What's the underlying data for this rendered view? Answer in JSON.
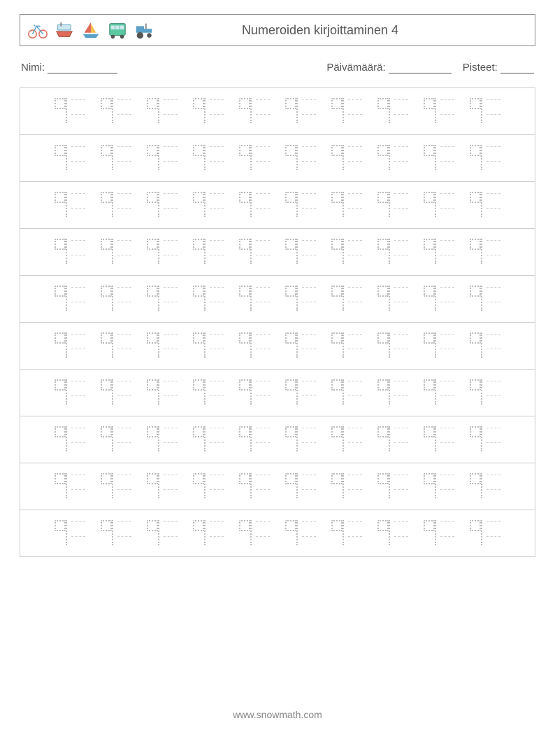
{
  "header": {
    "title": "Numeroiden kirjoittaminen 4",
    "icons": [
      "bicycle",
      "ship",
      "sailboat",
      "bus",
      "tractor"
    ]
  },
  "meta": {
    "name_label": "Nimi:",
    "date_label": "Päivämäärä:",
    "score_label": "Pisteet:"
  },
  "practice": {
    "digit": "9",
    "rows": 10,
    "cells_per_row": 10
  },
  "footer": {
    "url": "www.snowmath.com"
  }
}
